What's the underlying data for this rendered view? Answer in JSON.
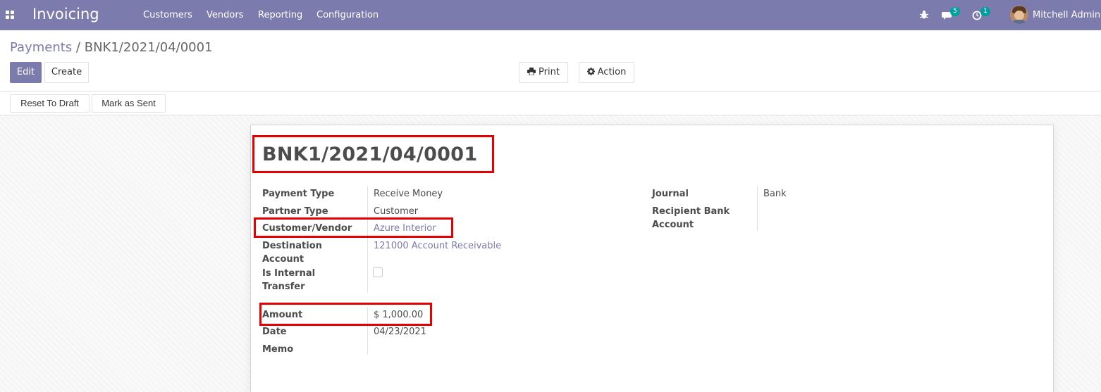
{
  "navbar": {
    "app_name": "Invoicing",
    "menu": [
      "Customers",
      "Vendors",
      "Reporting",
      "Configuration"
    ],
    "chat_count": "5",
    "activity_count": "1",
    "user_name": "Mitchell Admin"
  },
  "breadcrumb": {
    "parent": "Payments",
    "separator": "/",
    "current": "BNK1/2021/04/0001"
  },
  "buttons": {
    "edit": "Edit",
    "create": "Create",
    "print": "Print",
    "action": "Action",
    "reset_to_draft": "Reset To Draft",
    "mark_as_sent": "Mark as Sent"
  },
  "form": {
    "title": "BNK1/2021/04/0001",
    "payment_type_label": "Payment Type",
    "payment_type_value": "Receive Money",
    "partner_type_label": "Partner Type",
    "partner_type_value": "Customer",
    "customer_vendor_label": "Customer/Vendor",
    "customer_vendor_value": "Azure Interior",
    "destination_account_label_1": "Destination",
    "destination_account_label_2": "Account",
    "destination_account_value": "121000 Account Receivable",
    "is_internal_transfer_label_1": "Is Internal",
    "is_internal_transfer_label_2": "Transfer",
    "is_internal_transfer_checked": false,
    "amount_label": "Amount",
    "amount_value": "$ 1,000.00",
    "date_label": "Date",
    "date_value": "04/23/2021",
    "memo_label": "Memo",
    "journal_label": "Journal",
    "journal_value": "Bank",
    "recipient_bank_label_1": "Recipient Bank",
    "recipient_bank_label_2": "Account"
  },
  "colors": {
    "brand": "#7c7bad",
    "highlight": "#e60000",
    "badge": "#00a09d"
  },
  "icons": [
    "apps-grid-icon",
    "bug-icon",
    "chat-icon",
    "clock-icon",
    "print-icon",
    "gear-icon"
  ]
}
